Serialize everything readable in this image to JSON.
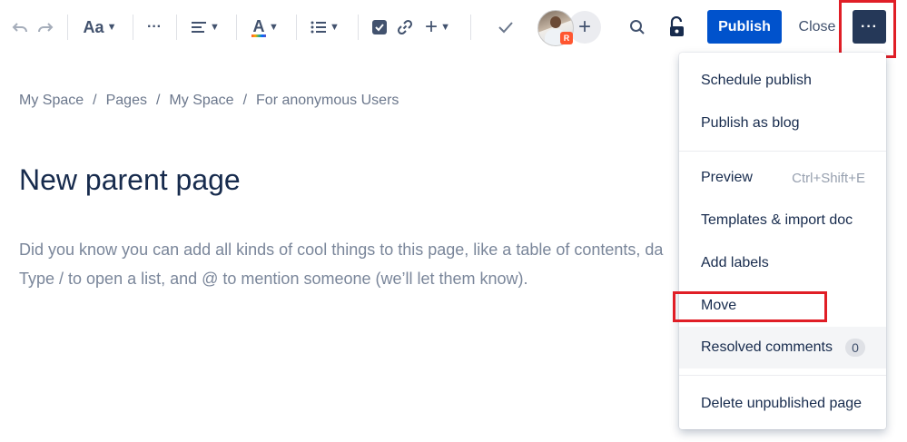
{
  "toolbar": {
    "undo_icon": "undo-icon",
    "redo_icon": "redo-icon",
    "text_style": "Aa",
    "text_color_glyph": "A",
    "more_formatting": "···",
    "collaborator_badge": "R",
    "publish_label": "Publish",
    "close_label": "Close",
    "more_label": "···"
  },
  "breadcrumb": [
    "My Space",
    "Pages",
    "My Space",
    "For anonymous Users"
  ],
  "page": {
    "title": "New parent page",
    "placeholder_line1": "Did you know you can add all kinds of cool things to this page, like a table of contents, da",
    "placeholder_line2": "Type / to open a list, and @ to mention someone (we’ll let them know)."
  },
  "menu": {
    "schedule_publish": "Schedule publish",
    "publish_as_blog": "Publish as blog",
    "preview": "Preview",
    "preview_shortcut": "Ctrl+Shift+E",
    "templates": "Templates & import doc",
    "add_labels": "Add labels",
    "move": "Move",
    "resolved_comments": "Resolved comments",
    "resolved_count": "0",
    "delete_unpublished": "Delete unpublished page"
  },
  "colors": {
    "primary": "#0052CC",
    "more_button": "#253858",
    "highlight": "#E01E26"
  }
}
